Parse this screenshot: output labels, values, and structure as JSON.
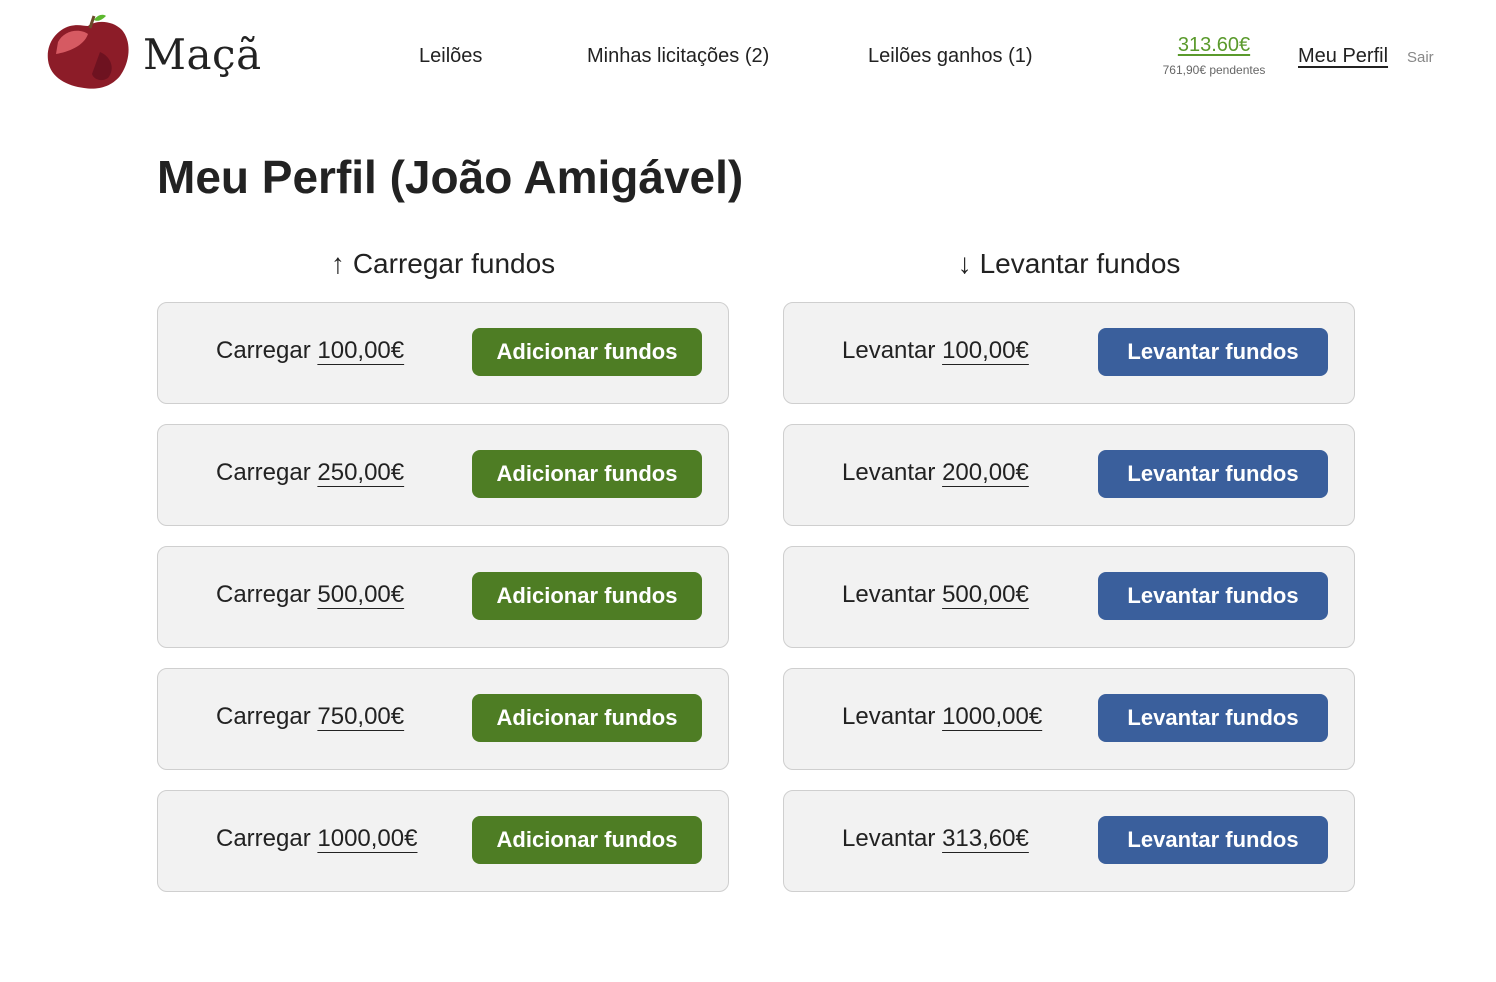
{
  "header": {
    "brand": "Maçã",
    "nav": [
      "Leilões",
      "Minhas licitações (2)",
      "Leilões ganhos (1)"
    ],
    "balance": "313.60€",
    "pending": "761,90€ pendentes",
    "profile": "Meu Perfil",
    "logout": "Sair"
  },
  "page": {
    "title": "Meu Perfil (João Amigável)"
  },
  "deposit": {
    "arrow": "↑",
    "heading": "Carregar fundos",
    "prefix": "Carregar",
    "button": "Adicionar fundos",
    "amounts": [
      "100,00€",
      "250,00€",
      "500,00€",
      "750,00€",
      "1000,00€"
    ]
  },
  "withdraw": {
    "arrow": "↓",
    "heading": "Levantar fundos",
    "prefix": "Levantar",
    "button": "Levantar fundos",
    "amounts": [
      "100,00€",
      "200,00€",
      "500,00€",
      "1000,00€",
      "313,60€"
    ]
  },
  "colors": {
    "deposit_button": "#4e7d24",
    "withdraw_button": "#3a5f9c",
    "balance": "#5a9a2c"
  }
}
